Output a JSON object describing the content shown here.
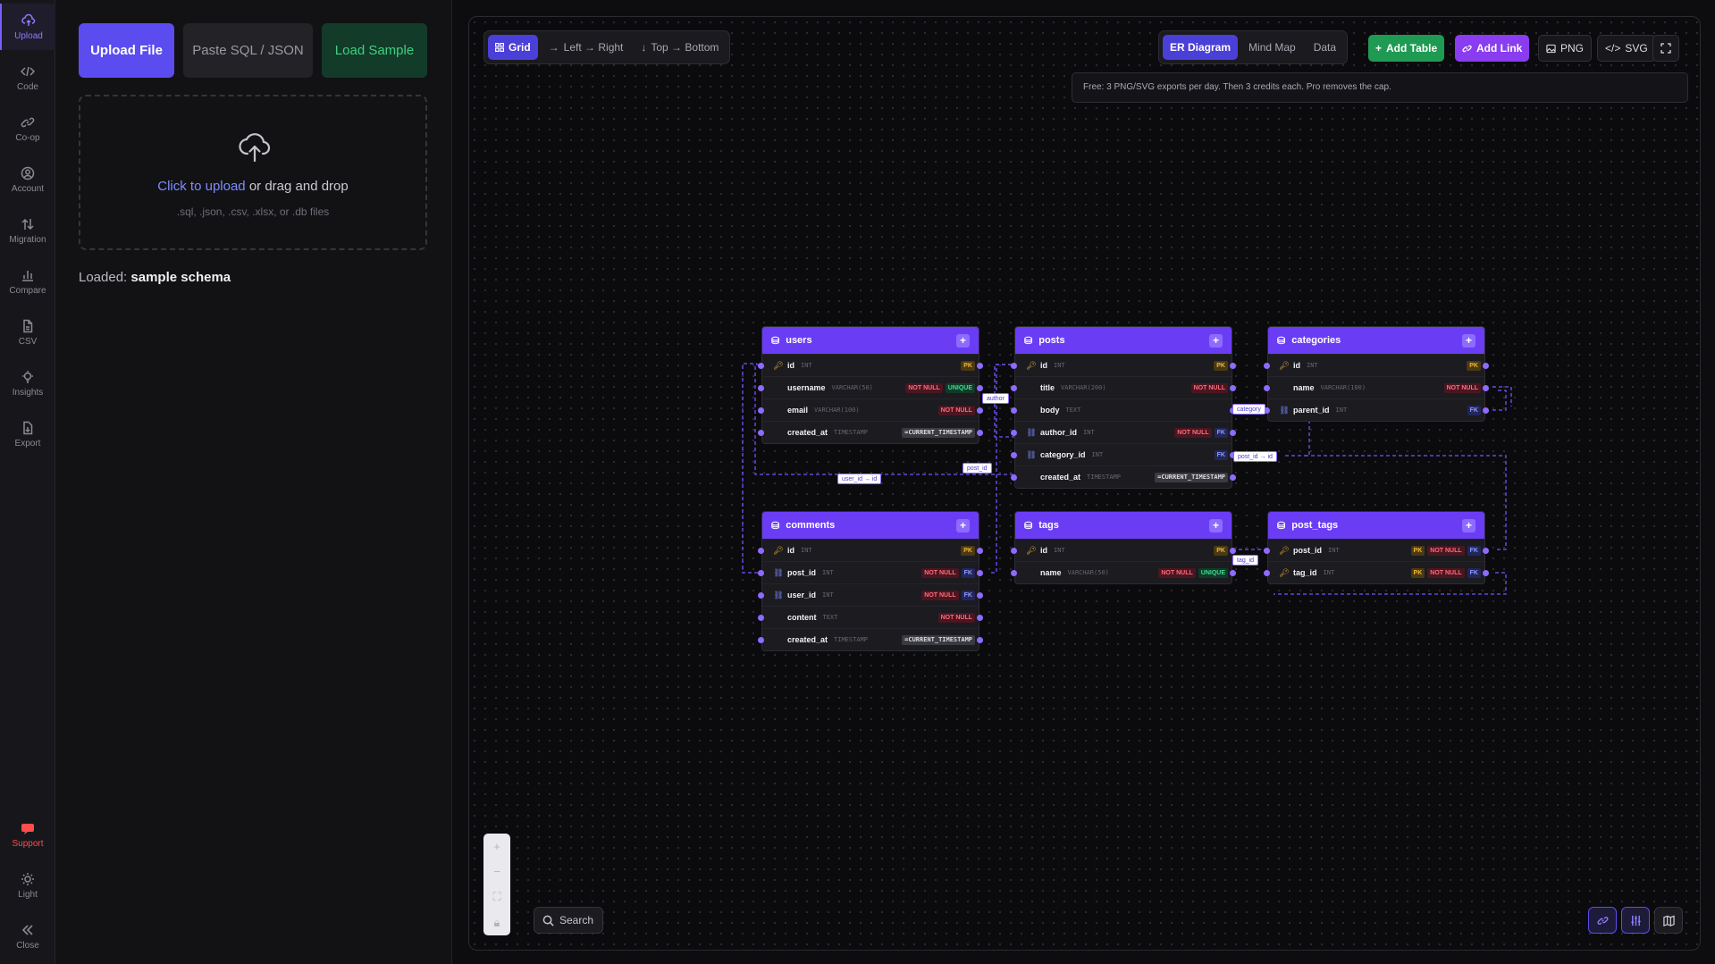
{
  "rail": {
    "items": [
      {
        "label": "Upload",
        "icon": "upload-icon"
      },
      {
        "label": "Code",
        "icon": "code-icon"
      },
      {
        "label": "Co-op",
        "icon": "link-icon"
      },
      {
        "label": "Account",
        "icon": "account-icon"
      },
      {
        "label": "Migration",
        "icon": "migration-icon"
      },
      {
        "label": "Compare",
        "icon": "bar-chart-icon"
      },
      {
        "label": "CSV",
        "icon": "file-icon"
      },
      {
        "label": "Insights",
        "icon": "bulb-icon"
      },
      {
        "label": "Export",
        "icon": "export-icon"
      }
    ],
    "bottom": [
      {
        "label": "Support",
        "icon": "support-icon"
      },
      {
        "label": "Light",
        "icon": "sun-icon"
      },
      {
        "label": "Close",
        "icon": "double-chevron-left-icon"
      }
    ]
  },
  "panel": {
    "upload_label": "Upload File",
    "paste_label": "Paste SQL / JSON",
    "sample_label": "Load Sample",
    "dropzone": {
      "link": "Click to upload",
      "rest": " or drag and drop",
      "hint": ".sql, .json, .csv, .xlsx, or .db files"
    },
    "loaded_prefix": "Loaded:",
    "loaded_value": "sample schema"
  },
  "toolbar": {
    "layout": [
      "Grid",
      "Left → Right",
      "Top → Bottom"
    ],
    "views": [
      "ER Diagram",
      "Mind Map",
      "Data"
    ],
    "add_table": "Add Table",
    "add_link": "Add Link",
    "png": "PNG",
    "svg": "SVG",
    "notice": "Free: 3 PNG/SVG exports per day. Then 3 credits each. Pro removes the cap."
  },
  "search_label": "Search",
  "colors": {
    "accent": "#6a3df5",
    "primary": "#5b4cf0",
    "green": "#1f9a53",
    "link": "#8e6bff"
  },
  "tables": [
    {
      "name": "users",
      "columns": [
        {
          "name": "id",
          "type": "INT",
          "key": "pk",
          "badges": [
            "PK"
          ]
        },
        {
          "name": "username",
          "type": "VARCHAR(50)",
          "key": "",
          "badges": [
            "NOT NULL",
            "UNIQUE"
          ]
        },
        {
          "name": "email",
          "type": "VARCHAR(100)",
          "key": "",
          "badges": [
            "NOT NULL"
          ]
        },
        {
          "name": "created_at",
          "type": "TIMESTAMP",
          "key": "",
          "badges": [
            "=CURRENT_TIMESTAMP"
          ]
        }
      ]
    },
    {
      "name": "posts",
      "columns": [
        {
          "name": "id",
          "type": "INT",
          "key": "pk",
          "badges": [
            "PK"
          ]
        },
        {
          "name": "title",
          "type": "VARCHAR(200)",
          "key": "",
          "badges": [
            "NOT NULL"
          ]
        },
        {
          "name": "body",
          "type": "TEXT",
          "key": "",
          "badges": []
        },
        {
          "name": "author_id",
          "type": "INT",
          "key": "fk",
          "badges": [
            "NOT NULL",
            "FK"
          ]
        },
        {
          "name": "category_id",
          "type": "INT",
          "key": "fk",
          "badges": [
            "FK"
          ]
        },
        {
          "name": "created_at",
          "type": "TIMESTAMP",
          "key": "",
          "badges": [
            "=CURRENT_TIMESTAMP"
          ]
        }
      ]
    },
    {
      "name": "categories",
      "columns": [
        {
          "name": "id",
          "type": "INT",
          "key": "pk",
          "badges": [
            "PK"
          ]
        },
        {
          "name": "name",
          "type": "VARCHAR(100)",
          "key": "",
          "badges": [
            "NOT NULL"
          ]
        },
        {
          "name": "parent_id",
          "type": "INT",
          "key": "fk",
          "badges": [
            "FK"
          ]
        }
      ]
    },
    {
      "name": "comments",
      "columns": [
        {
          "name": "id",
          "type": "INT",
          "key": "pk",
          "badges": [
            "PK"
          ]
        },
        {
          "name": "post_id",
          "type": "INT",
          "key": "fk",
          "badges": [
            "NOT NULL",
            "FK"
          ]
        },
        {
          "name": "user_id",
          "type": "INT",
          "key": "fk",
          "badges": [
            "NOT NULL",
            "FK"
          ]
        },
        {
          "name": "content",
          "type": "TEXT",
          "key": "",
          "badges": [
            "NOT NULL"
          ]
        },
        {
          "name": "created_at",
          "type": "TIMESTAMP",
          "key": "",
          "badges": [
            "=CURRENT_TIMESTAMP"
          ]
        }
      ]
    },
    {
      "name": "tags",
      "columns": [
        {
          "name": "id",
          "type": "INT",
          "key": "pk",
          "badges": [
            "PK"
          ]
        },
        {
          "name": "name",
          "type": "VARCHAR(50)",
          "key": "",
          "badges": [
            "NOT NULL",
            "UNIQUE"
          ]
        }
      ]
    },
    {
      "name": "post_tags",
      "columns": [
        {
          "name": "post_id",
          "type": "INT",
          "key": "pk",
          "badges": [
            "PK",
            "NOT NULL",
            "FK"
          ]
        },
        {
          "name": "tag_id",
          "type": "INT",
          "key": "pk",
          "badges": [
            "PK",
            "NOT NULL",
            "FK"
          ]
        }
      ]
    }
  ],
  "edge_labels": [
    "author",
    "user_id → id",
    "post_id",
    "category",
    "post_id → id",
    "tag_id"
  ]
}
